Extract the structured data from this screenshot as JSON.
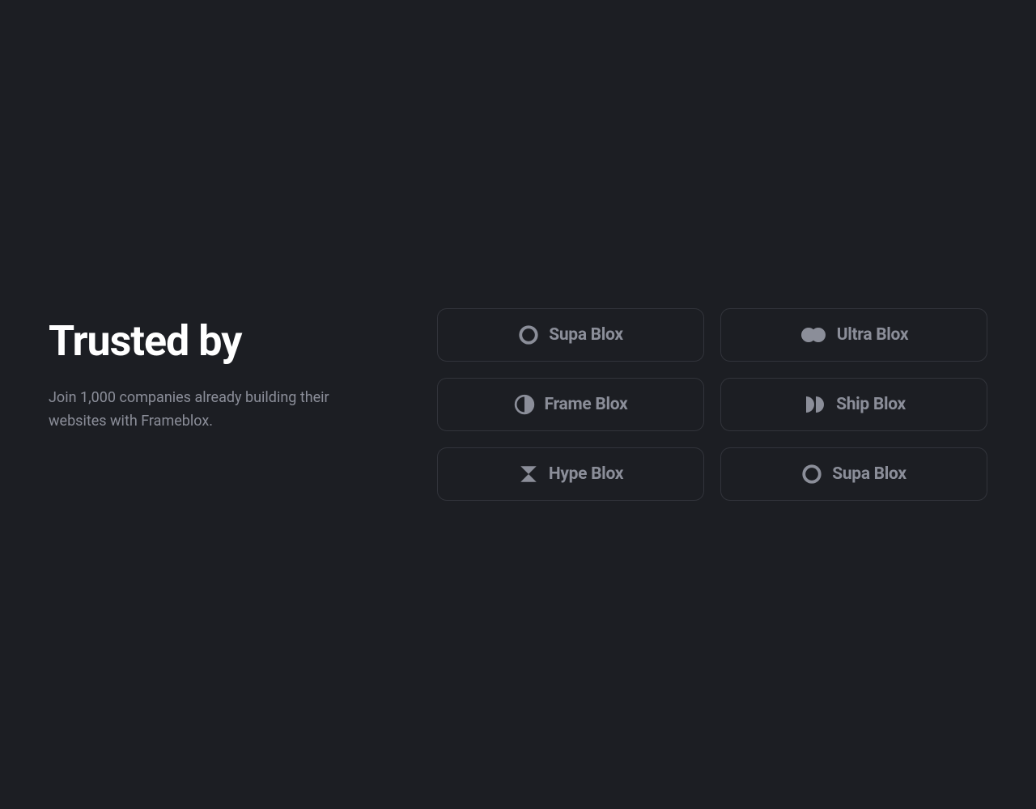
{
  "heading": "Trusted by",
  "subheading": "Join 1,000 companies already building their websites with Frameblox.",
  "logos": [
    {
      "name": "Supa Blox",
      "icon": "circle-outline"
    },
    {
      "name": "Ultra Blox",
      "icon": "two-circles-overlap"
    },
    {
      "name": "Frame Blox",
      "icon": "half-circle"
    },
    {
      "name": "Ship Blox",
      "icon": "two-half-circles"
    },
    {
      "name": "Hype Blox",
      "icon": "hourglass"
    },
    {
      "name": "Supa Blox",
      "icon": "circle-outline"
    }
  ],
  "colors": {
    "bg": "#1c1e23",
    "border": "#32343b",
    "text_primary": "#ffffff",
    "text_muted": "#8b8e99"
  }
}
